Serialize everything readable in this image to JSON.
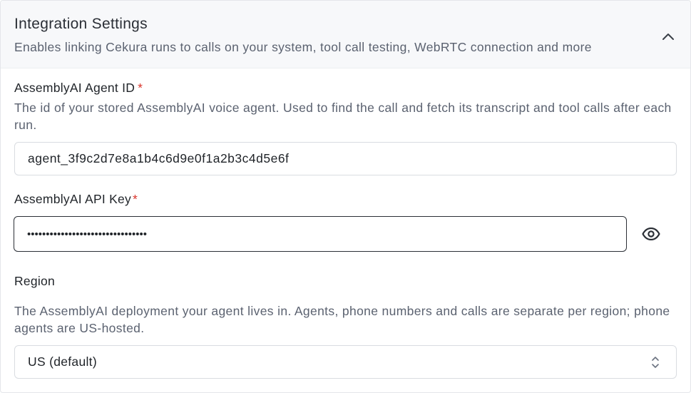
{
  "section": {
    "title": "Integration Settings",
    "subtitle": "Enables linking Cekura runs to calls on your system, tool call testing, WebRTC connection and more"
  },
  "icons": {
    "collapse": "chevron-up-icon",
    "visibility": "eye-icon",
    "select": "chevron-up-down-icon"
  },
  "fields": {
    "agent_id": {
      "label": "AssemblyAI Agent ID",
      "required_marker": "*",
      "help": "The id of your stored AssemblyAI voice agent. Used to find the call and fetch its transcript and tool calls after each run.",
      "value": "agent_3f9c2d7e8a1b4c6d9e0f1a2b3c4d5e6f"
    },
    "api_key": {
      "label": "AssemblyAI API Key",
      "required_marker": "*",
      "value": "••••••••••••••••••••••••••••••••"
    },
    "region": {
      "label": "Region",
      "help": "The AssemblyAI deployment your agent lives in. Agents, phone numbers and calls are separate per region; phone agents are US-hosted.",
      "selected": "US (default)"
    }
  },
  "colors": {
    "required": "#d9342b",
    "header_bg": "#f7f8fa",
    "muted_text": "#5b6270"
  }
}
